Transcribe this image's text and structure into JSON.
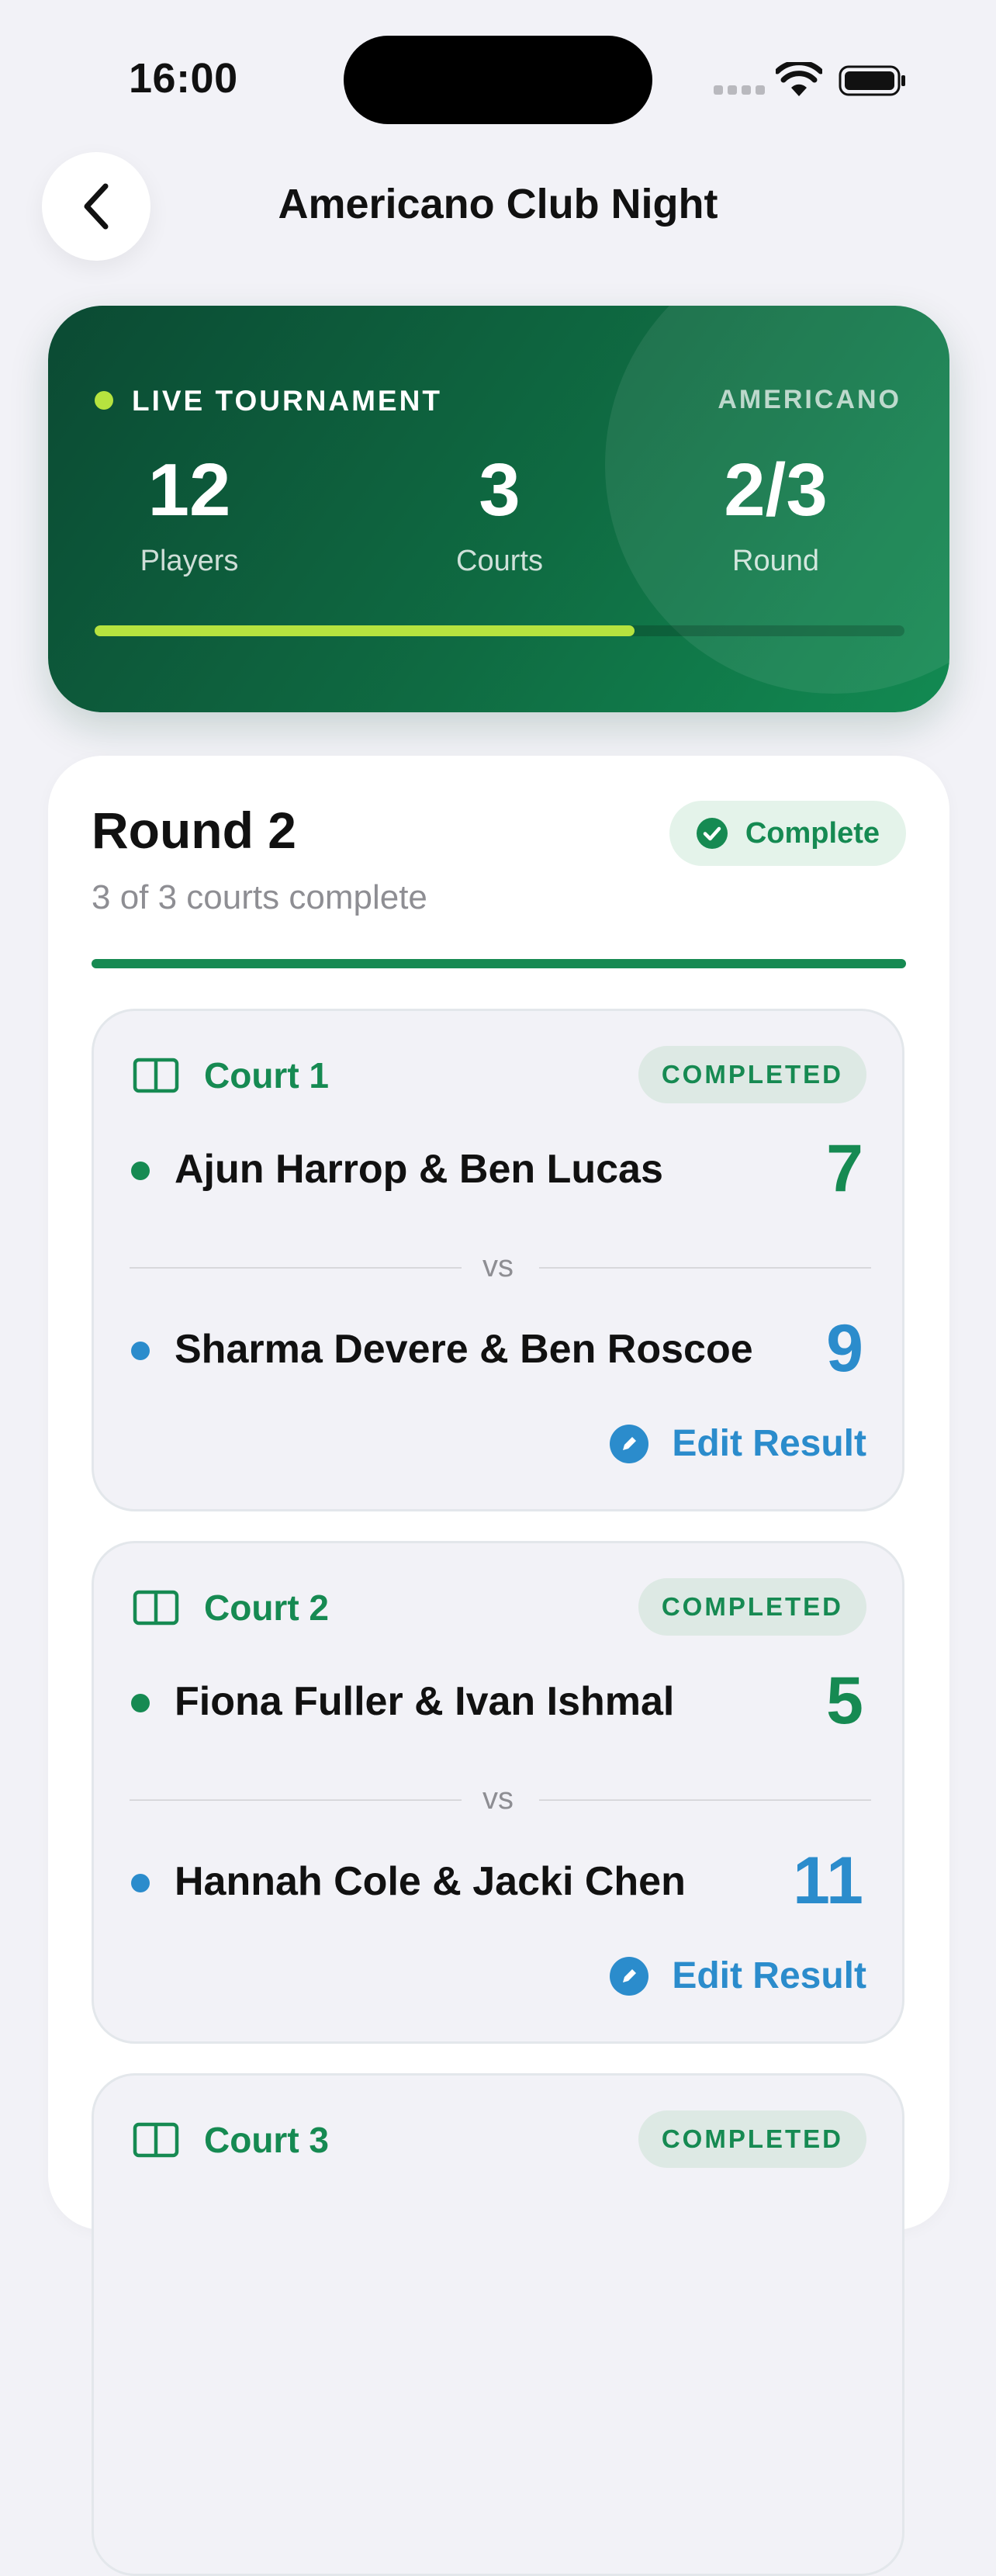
{
  "status_bar": {
    "time": "16:00"
  },
  "nav": {
    "title": "Americano Club Night"
  },
  "hero": {
    "live_label": "LIVE TOURNAMENT",
    "format": "AMERICANO",
    "stats": [
      {
        "value": "12",
        "label": "Players"
      },
      {
        "value": "3",
        "label": "Courts"
      },
      {
        "value": "2/3",
        "label": "Round"
      }
    ],
    "progress_fraction": 0.6667
  },
  "round": {
    "title": "Round 2",
    "subtitle": "3 of 3 courts complete",
    "status": "Complete",
    "progress_fraction": 1.0
  },
  "courts": [
    {
      "name": "Court 1",
      "status": "COMPLETED",
      "team1": {
        "players": "Ajun Harrop & Ben Lucas",
        "score": "7"
      },
      "vs": "vs",
      "team2": {
        "players": "Sharma Devere & Ben Roscoe",
        "score": "9"
      },
      "action": "Edit Result"
    },
    {
      "name": "Court 2",
      "status": "COMPLETED",
      "team1": {
        "players": "Fiona Fuller & Ivan Ishmal",
        "score": "5"
      },
      "vs": "vs",
      "team2": {
        "players": "Hannah Cole & Jacki Chen",
        "score": "11"
      },
      "action": "Edit Result"
    },
    {
      "name": "Court 3",
      "status": "COMPLETED"
    }
  ],
  "colors": {
    "accent_green": "#168a52",
    "accent_blue": "#2b8ccc",
    "lime": "#b6e33f",
    "hero_dark": "#0b4a33"
  },
  "icons": {
    "back": "chevron-left-icon",
    "court": "court-icon",
    "complete": "check-circle-icon",
    "edit": "pencil-icon"
  }
}
